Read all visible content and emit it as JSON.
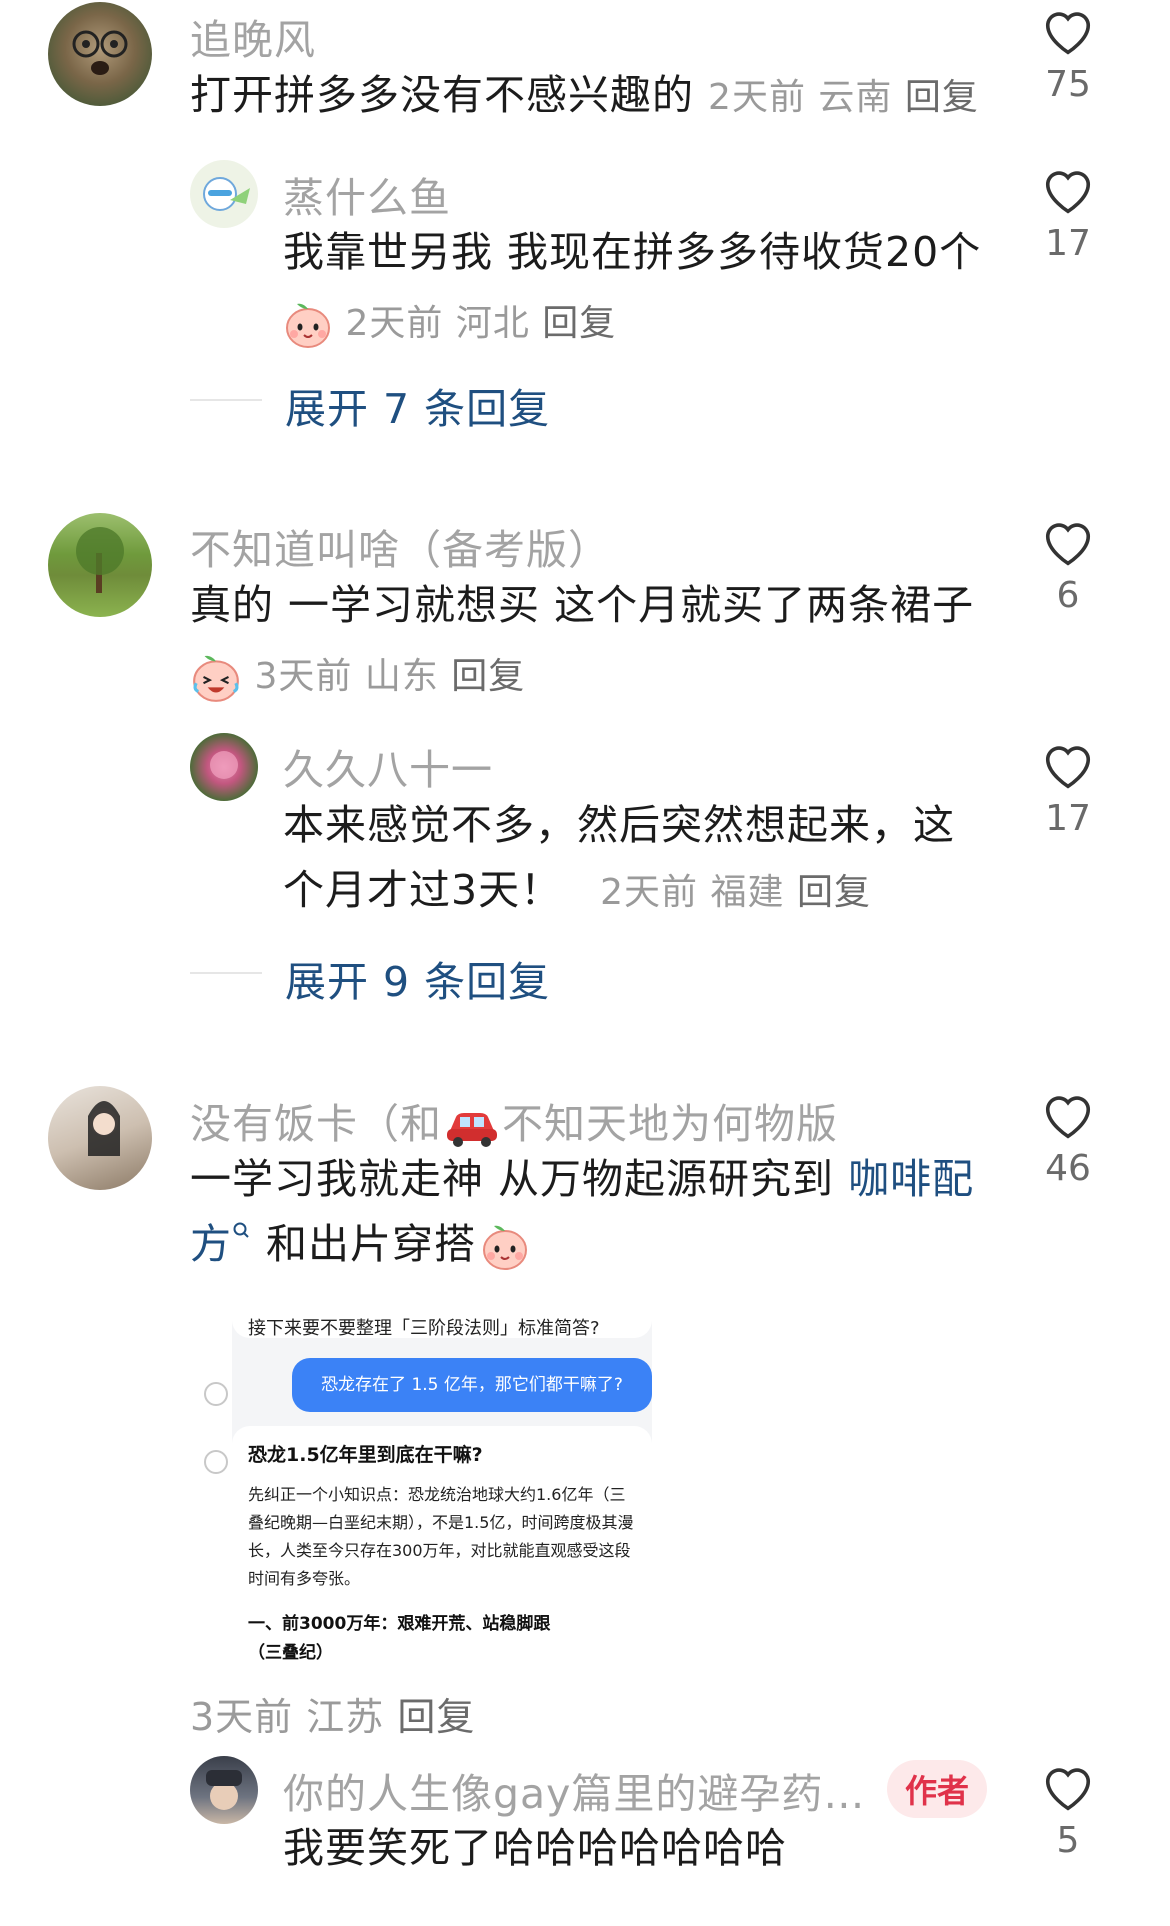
{
  "comments": [
    {
      "username": "追晚风",
      "text": "打开拼多多没有不感兴趣的",
      "time": "2天前",
      "location": "云南",
      "reply": "回复",
      "likes": "75"
    },
    {
      "username": "蒸什么鱼",
      "text": "我靠世另我 我现在拼多多待收货20个",
      "time": "2天前",
      "location": "河北",
      "reply": "回复",
      "likes": "17",
      "emoji": "peach-face"
    },
    {
      "expand": "展开 7 条回复"
    },
    {
      "username": "不知道叫啥（备考版）",
      "text": "真的 一学习就想买 这个月就买了两条裙子",
      "time": "3天前",
      "location": "山东",
      "reply": "回复",
      "likes": "6",
      "emoji": "crying-laughing-face"
    },
    {
      "username": "久久八十一",
      "text_line1": "本来感觉不多，然后突然想起来，这",
      "text_line2": "个月才过3天！",
      "time": "2天前",
      "location": "福建",
      "reply": "回复",
      "likes": "17"
    },
    {
      "expand": "展开 9 条回复"
    },
    {
      "username_part1": "没有饭卡（和",
      "username_part2": "不知天地为何物版",
      "text_line1": "一学习我就走神 从万物起源研究到 ",
      "text_link": "咖啡配",
      "text_line2_link": "方",
      "text_line2": " 和出片穿搭",
      "time": "3天前",
      "location": "江苏",
      "reply": "回复",
      "likes": "46"
    },
    {
      "username": "你的人生像gay篇里的避孕药…",
      "badge": "作者",
      "text": "我要笑死了哈哈哈哈哈哈哈",
      "likes": "5"
    }
  ],
  "chat_image": {
    "prompt_top": "接下来要不要整理「三阶段法则」标准简答?",
    "user_msg": "恐龙存在了 1.5 亿年，那它们都干嘛了?",
    "answer_title": "恐龙1.5亿年里到底在干嘛?",
    "answer_body": "先纠正一个小知识点：恐龙统治地球大约1.6亿年（三叠纪晚期—白垩纪末期），不是1.5亿，时间跨度极其漫长，人类至今只存在300万年，对比就能直观感受这段时间有多夸张。",
    "answer_section": "一、前3000万年：艰难开荒、站稳脚跟",
    "answer_section_cont": "（三叠纪）"
  }
}
